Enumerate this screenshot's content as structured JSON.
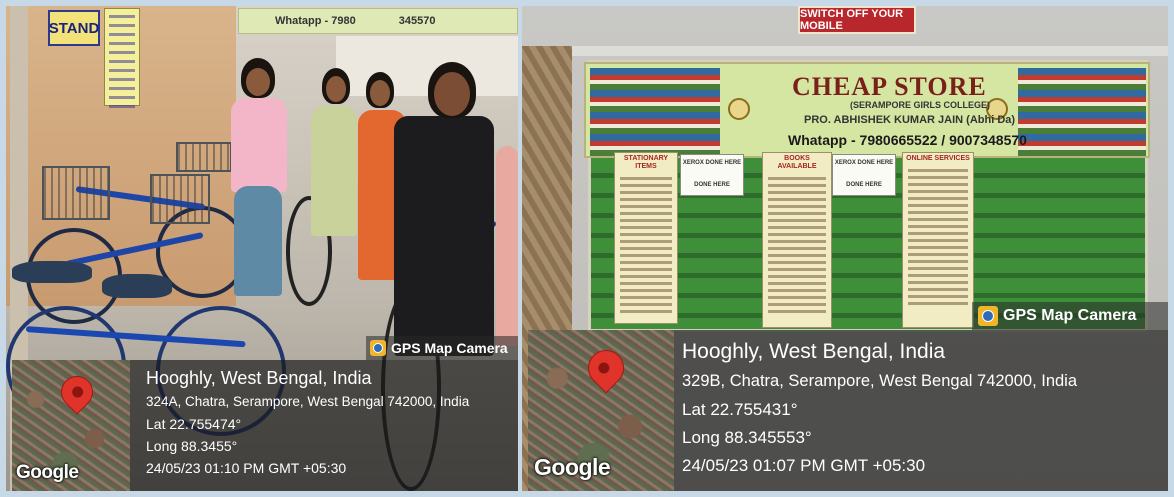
{
  "left_photo": {
    "stand_sign": "STAND",
    "banner_text": "Whatapp - 7980",
    "banner_text_2": "345570",
    "gps_tag": "GPS Map Camera",
    "location_title": "Hooghly, West Bengal, India",
    "address": "324A, Chatra, Serampore, West Bengal 742000, India",
    "lat": "Lat 22.755474°",
    "long": "Long 88.3455°",
    "datetime": "24/05/23 01:10 PM GMT +05:30",
    "map_brand": "Google"
  },
  "right_photo": {
    "top_sign": "SWITCH OFF YOUR MOBILE",
    "store_name": "CHEAP STORE",
    "college": "(SERAMPORE GIRLS COLLEGE)",
    "proprietor": "PRO. ABHISHEK KUMAR JAIN (Abhi Da)",
    "phone": "Whatapp - 7980665522 / 9007348570",
    "notices": {
      "stationary": "STATIONARY ITEMS",
      "xerox_1": "XEROX DONE HERE",
      "books": "BOOKS AVAILABLE",
      "xerox_2": "XEROX DONE HERE",
      "online": "ONLINE SERVICES"
    },
    "xerox_done": "DONE HERE",
    "gps_tag": "GPS Map Camera",
    "location_title": "Hooghly, West Bengal, India",
    "address": "329B, Chatra, Serampore, West Bengal 742000, India",
    "lat": "Lat 22.755431°",
    "long": "Long 88.345553°",
    "datetime": "24/05/23 01:07 PM GMT +05:30",
    "map_brand": "Google"
  },
  "colors": {
    "page_border": "#c7d8e6",
    "pin": "#e0332a",
    "board_green": "#3f8f3a",
    "store_title": "#7a1f1a"
  }
}
